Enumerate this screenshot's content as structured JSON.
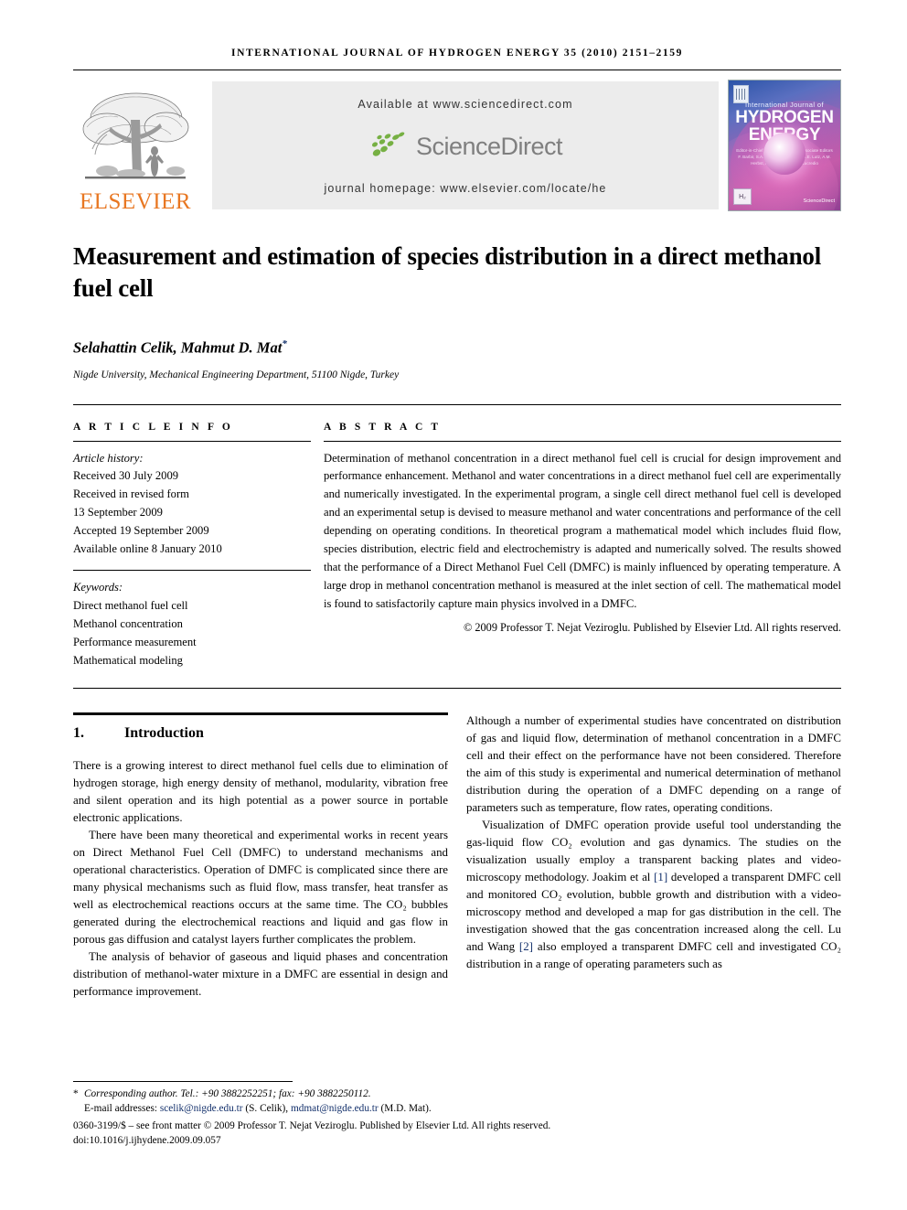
{
  "running_head": "International Journal of Hydrogen Energy 35 (2010) 2151–2159",
  "masthead": {
    "elsevier_wordmark": "ELSEVIER",
    "available_at": "Available at www.sciencedirect.com",
    "sciencedirect_wordmark": "ScienceDirect",
    "journal_homepage": "journal homepage: www.elsevier.com/locate/he",
    "cover": {
      "intl_line": "International Journal of",
      "title_line1": "HYDROGEN",
      "title_line2": "ENERGY",
      "editors": "Editor-in-Chief  T. Nejat Veziroglu   ·   Associate Editors  F. Barbir, S.A. Sherif, D.A.J. Rand, A.E. Lutz, A.M. Herbst, A.A. Martiñez, D.A. Lucredio",
      "he_mark": "H₂",
      "sciencedirect_tag": "ScienceDirect"
    }
  },
  "article": {
    "title": "Measurement and estimation of species distribution in a direct methanol fuel cell",
    "authors": "Selahattin Celik, Mahmut D. Mat",
    "author_footnote_marker": "*",
    "affiliation": "Nigde University, Mechanical Engineering Department, 51100 Nigde, Turkey"
  },
  "article_info": {
    "heading": "A R T I C L E   I N F O",
    "history_label": "Article history:",
    "history": [
      "Received 30 July 2009",
      "Received in revised form",
      "13 September 2009",
      "Accepted 19 September 2009",
      "Available online 8 January 2010"
    ],
    "keywords_label": "Keywords:",
    "keywords": [
      "Direct methanol fuel cell",
      "Methanol concentration",
      "Performance measurement",
      "Mathematical modeling"
    ]
  },
  "abstract": {
    "heading": "A B S T R A C T",
    "text": "Determination of methanol concentration in a direct methanol fuel cell is crucial for design improvement and performance enhancement. Methanol and water concentrations in a direct methanol fuel cell are experimentally and numerically investigated. In the experimental program, a single cell direct methanol fuel cell is developed and an experimental setup is devised to measure methanol and water concentrations and performance of the cell depending on operating conditions. In theoretical program a mathematical model which includes fluid flow, species distribution, electric field and electrochemistry is adapted and numerically solved. The results showed that the performance of a Direct Methanol Fuel Cell (DMFC) is mainly influenced by operating temperature. A large drop in methanol concentration methanol is measured at the inlet section of cell. The mathematical model is found to satisfactorily capture main physics involved in a DMFC.",
    "copyright": "© 2009 Professor T. Nejat Veziroglu. Published by Elsevier Ltd. All rights reserved."
  },
  "body": {
    "section_number": "1.",
    "section_title": "Introduction",
    "left_paragraphs": [
      "There is a growing interest to direct methanol fuel cells due to elimination of hydrogen storage, high energy density of methanol, modularity, vibration free and silent operation and its high potential as a power source in portable electronic applications.",
      "There have been many theoretical and experimental works in recent years on Direct Methanol Fuel Cell (DMFC) to understand mechanisms and operational characteristics. Operation of DMFC is complicated since there are many physical mechanisms such as fluid flow, mass transfer, heat transfer as well as electrochemical reactions occurs at the same time. The CO₂ bubbles generated during the electrochemical reactions and liquid and gas flow in porous gas diffusion and catalyst layers further complicates the problem.",
      "The analysis of behavior of gaseous and liquid phases and concentration distribution of methanol-water mixture in a DMFC are essential in design and performance improvement."
    ],
    "right_paragraph_1": "Although a number of experimental studies have concentrated on distribution of gas and liquid flow, determination of methanol concentration in a DMFC cell and their effect on the performance have not been considered. Therefore the aim of this study is experimental and numerical determination of methanol distribution during the operation of a DMFC depending on a range of parameters such as temperature, flow rates, operating conditions.",
    "right_paragraph_2_part1": "Visualization of DMFC operation provide useful tool understanding the gas-liquid flow CO₂ evolution and gas dynamics. The studies on the visualization usually employ a transparent backing plates and video-microscopy methodology. Joakim et al ",
    "right_citation_1": "[1]",
    "right_paragraph_2_part2": " developed a transparent DMFC cell and monitored CO₂ evolution, bubble growth and distribution with a video-microscopy method and developed a map for gas distribution in the cell. The investigation showed that the gas concentration increased along the cell. Lu and Wang ",
    "right_citation_2": "[2]",
    "right_paragraph_2_part3": " also employed a transparent DMFC cell and investigated CO₂ distribution in a range of operating parameters such as"
  },
  "footnotes": {
    "star": "*",
    "corresponding": "Corresponding author. Tel.: +90 3882252251; fax: +90 3882250112.",
    "email_label": "E-mail addresses: ",
    "email1": "scelik@nigde.edu.tr",
    "email1_name": " (S. Celik), ",
    "email2": "mdmat@nigde.edu.tr",
    "email2_name": " (M.D. Mat).",
    "issn_line": "0360-3199/$ – see front matter © 2009 Professor T. Nejat Veziroglu. Published by Elsevier Ltd. All rights reserved.",
    "doi_line": "doi:10.1016/j.ijhydene.2009.09.057"
  },
  "colors": {
    "elsevier_orange": "#E87722",
    "sciencedirect_green": "#6aa442",
    "link_blue": "#13306b",
    "banner_gray": "#ececec"
  }
}
